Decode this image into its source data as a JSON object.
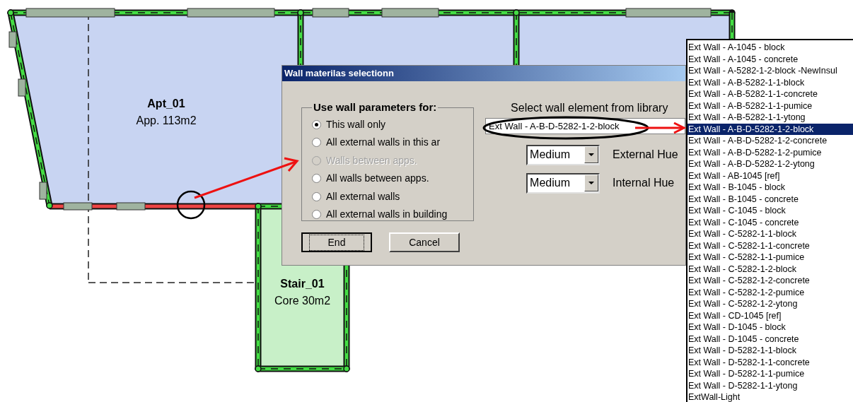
{
  "floor_plan": {
    "rooms": [
      {
        "name": "Apt_01",
        "area": "App. 113m2"
      },
      {
        "name": "Stair_01",
        "area": "Core 30m2"
      }
    ]
  },
  "dialog": {
    "title": "Wall materilas selectionn",
    "group": {
      "legend": "Use wall parameters for:",
      "options": [
        {
          "label": "This wall only",
          "selected": true,
          "disabled": false
        },
        {
          "label": "All external walls in this ar",
          "selected": false,
          "disabled": false
        },
        {
          "label": "Walls between apps.",
          "selected": false,
          "disabled": true
        },
        {
          "label": "All walls between apps.",
          "selected": false,
          "disabled": false
        },
        {
          "label": "All external walls",
          "selected": false,
          "disabled": false
        },
        {
          "label": "All external walls in building",
          "selected": false,
          "disabled": false
        }
      ]
    },
    "library_label": "Select wall element from library",
    "wall_element": {
      "value": "Ext Wall - A-B-D-5282-1-2-block"
    },
    "hues": [
      {
        "value": "Medium",
        "label": "External Hue"
      },
      {
        "value": "Medium",
        "label": "Internal Hue"
      }
    ],
    "buttons": [
      {
        "label": "End",
        "focused": true
      },
      {
        "label": "Cancel",
        "focused": false
      }
    ]
  },
  "library_list": {
    "items": [
      {
        "label": "Ext Wall - A-1045 - block",
        "selected": false
      },
      {
        "label": "Ext Wall - A-1045 - concrete",
        "selected": false
      },
      {
        "label": "Ext Wall - A-5282-1-2-block -NewInsul",
        "selected": false
      },
      {
        "label": "Ext Wall - A-B-5282-1-1-block",
        "selected": false
      },
      {
        "label": "Ext Wall - A-B-5282-1-1-concrete",
        "selected": false
      },
      {
        "label": "Ext Wall - A-B-5282-1-1-pumice",
        "selected": false
      },
      {
        "label": "Ext Wall - A-B-5282-1-1-ytong",
        "selected": false
      },
      {
        "label": "Ext Wall - A-B-D-5282-1-2-block",
        "selected": true
      },
      {
        "label": "Ext Wall - A-B-D-5282-1-2-concrete",
        "selected": false
      },
      {
        "label": "Ext Wall - A-B-D-5282-1-2-pumice",
        "selected": false
      },
      {
        "label": "Ext Wall - A-B-D-5282-1-2-ytong",
        "selected": false
      },
      {
        "label": "Ext Wall - AB-1045 [ref]",
        "selected": false
      },
      {
        "label": "Ext Wall - B-1045 - block",
        "selected": false
      },
      {
        "label": "Ext Wall - B-1045 - concrete",
        "selected": false
      },
      {
        "label": "Ext Wall - C-1045 - block",
        "selected": false
      },
      {
        "label": "Ext Wall - C-1045 - concrete",
        "selected": false
      },
      {
        "label": "Ext Wall - C-5282-1-1-block",
        "selected": false
      },
      {
        "label": "Ext Wall - C-5282-1-1-concrete",
        "selected": false
      },
      {
        "label": "Ext Wall - C-5282-1-1-pumice",
        "selected": false
      },
      {
        "label": "Ext Wall - C-5282-1-2-block",
        "selected": false
      },
      {
        "label": "Ext Wall - C-5282-1-2-concrete",
        "selected": false
      },
      {
        "label": "Ext Wall - C-5282-1-2-pumice",
        "selected": false
      },
      {
        "label": "Ext Wall - C-5282-1-2-ytong",
        "selected": false
      },
      {
        "label": "Ext Wall - CD-1045 [ref]",
        "selected": false
      },
      {
        "label": "Ext Wall - D-1045 - block",
        "selected": false
      },
      {
        "label": "Ext Wall - D-1045 - concrete",
        "selected": false
      },
      {
        "label": "Ext Wall - D-5282-1-1-block",
        "selected": false
      },
      {
        "label": "Ext Wall - D-5282-1-1-concrete",
        "selected": false
      },
      {
        "label": "Ext Wall - D-5282-1-1-pumice",
        "selected": false
      },
      {
        "label": "Ext Wall - D-5282-1-1-ytong",
        "selected": false
      },
      {
        "label": "ExtWall-Light",
        "selected": false
      }
    ]
  }
}
